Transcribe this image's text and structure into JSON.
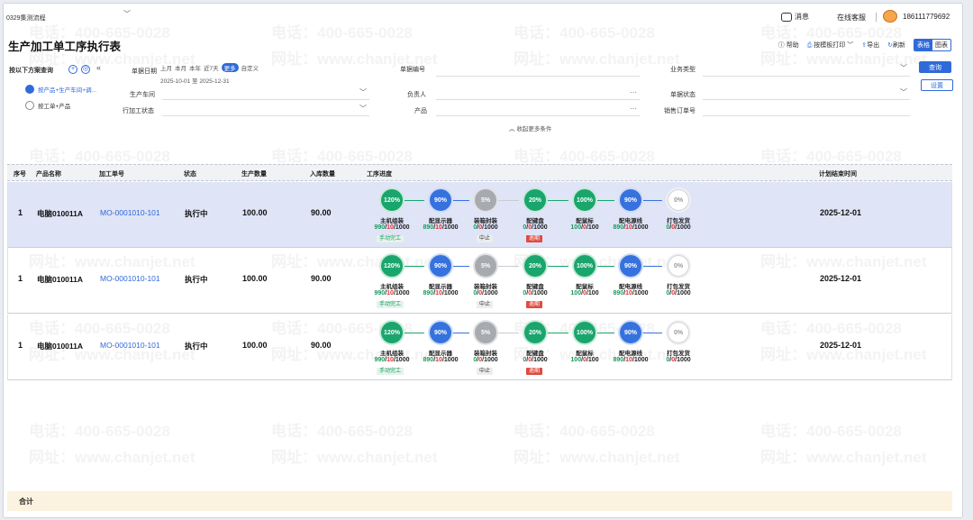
{
  "topbar": {
    "process_name": "0329集测流程",
    "message": "消息",
    "service": "在线客服",
    "phone": "186111779692"
  },
  "page": {
    "title": "生产加工单工序执行表"
  },
  "toolbar": {
    "help": "帮助",
    "print": "按模板打印",
    "export": "导出",
    "refresh": "刷新",
    "view_table": "表格",
    "view_chart": "图表"
  },
  "sidebar": {
    "query_label": "按以下方案查询",
    "items": [
      {
        "label": "按产品+生产车间+调..."
      },
      {
        "label": "按工单+产品"
      }
    ]
  },
  "filters": {
    "date_label": "单据日期",
    "date_shortcuts": [
      "上月",
      "本月",
      "本年",
      "近7天",
      "更多",
      "自定义"
    ],
    "date_range": "2025-10-01 至 2025-12-31",
    "doc_no_label": "单据编号",
    "biz_type_label": "业务类型",
    "workshop_label": "生产车间",
    "owner_label": "负责人",
    "doc_status_label": "单据状态",
    "line_status_label": "行加工状态",
    "product_label": "产品",
    "sales_order_label": "销售订单号",
    "collapse": "收起更多条件",
    "query_btn": "查询",
    "settings_btn": "设置"
  },
  "table": {
    "headers": {
      "seq": "序号",
      "product": "产品名称",
      "order_no": "加工单号",
      "status": "状态",
      "qty": "生产数量",
      "stock_in": "入库数量",
      "progress": "工序进度",
      "end_time": "计划结束时间"
    },
    "rows": [
      {
        "seq": "1",
        "product": "电脑010011A",
        "order_no": "MO-0001010-101",
        "status": "执行中",
        "qty": "100.00",
        "stock_in": "90.00",
        "end_time": "2025-12-01"
      },
      {
        "seq": "1",
        "product": "电脑010011A",
        "order_no": "MO-0001010-101",
        "status": "执行中",
        "qty": "100.00",
        "stock_in": "90.00",
        "end_time": "2025-12-01"
      },
      {
        "seq": "1",
        "product": "电脑010011A",
        "order_no": "MO-0001010-101",
        "status": "执行中",
        "qty": "100.00",
        "stock_in": "90.00",
        "end_time": "2025-12-01"
      }
    ],
    "steps": [
      {
        "pct": "120%",
        "name": "主机组装",
        "done": "990",
        "bad": "10",
        "total": "1000",
        "tag": "手动完工",
        "color": "green"
      },
      {
        "pct": "90%",
        "name": "配显示器",
        "done": "890",
        "bad": "10",
        "total": "1000",
        "tag": "",
        "color": "blue"
      },
      {
        "pct": "5%",
        "name": "装箱封装",
        "done": "0",
        "bad": "0",
        "total": "1000",
        "tag": "中止",
        "color": "gray"
      },
      {
        "pct": "20%",
        "name": "配键盘",
        "done": "0",
        "bad": "0",
        "total": "1000",
        "tag": "逾期",
        "color": "green"
      },
      {
        "pct": "100%",
        "name": "配鼠标",
        "done": "100",
        "bad": "0",
        "total": "100",
        "tag": "",
        "color": "green"
      },
      {
        "pct": "90%",
        "name": "配电源线",
        "done": "890",
        "bad": "10",
        "total": "1000",
        "tag": "",
        "color": "blue"
      },
      {
        "pct": "0%",
        "name": "打包发货",
        "done": "0",
        "bad": "0",
        "total": "1000",
        "tag": "",
        "color": "white"
      }
    ]
  },
  "footer": {
    "total_label": "合计"
  },
  "watermark": {
    "phone": "电话：400-665-0028",
    "site": "网址：www.chanjet.net"
  }
}
